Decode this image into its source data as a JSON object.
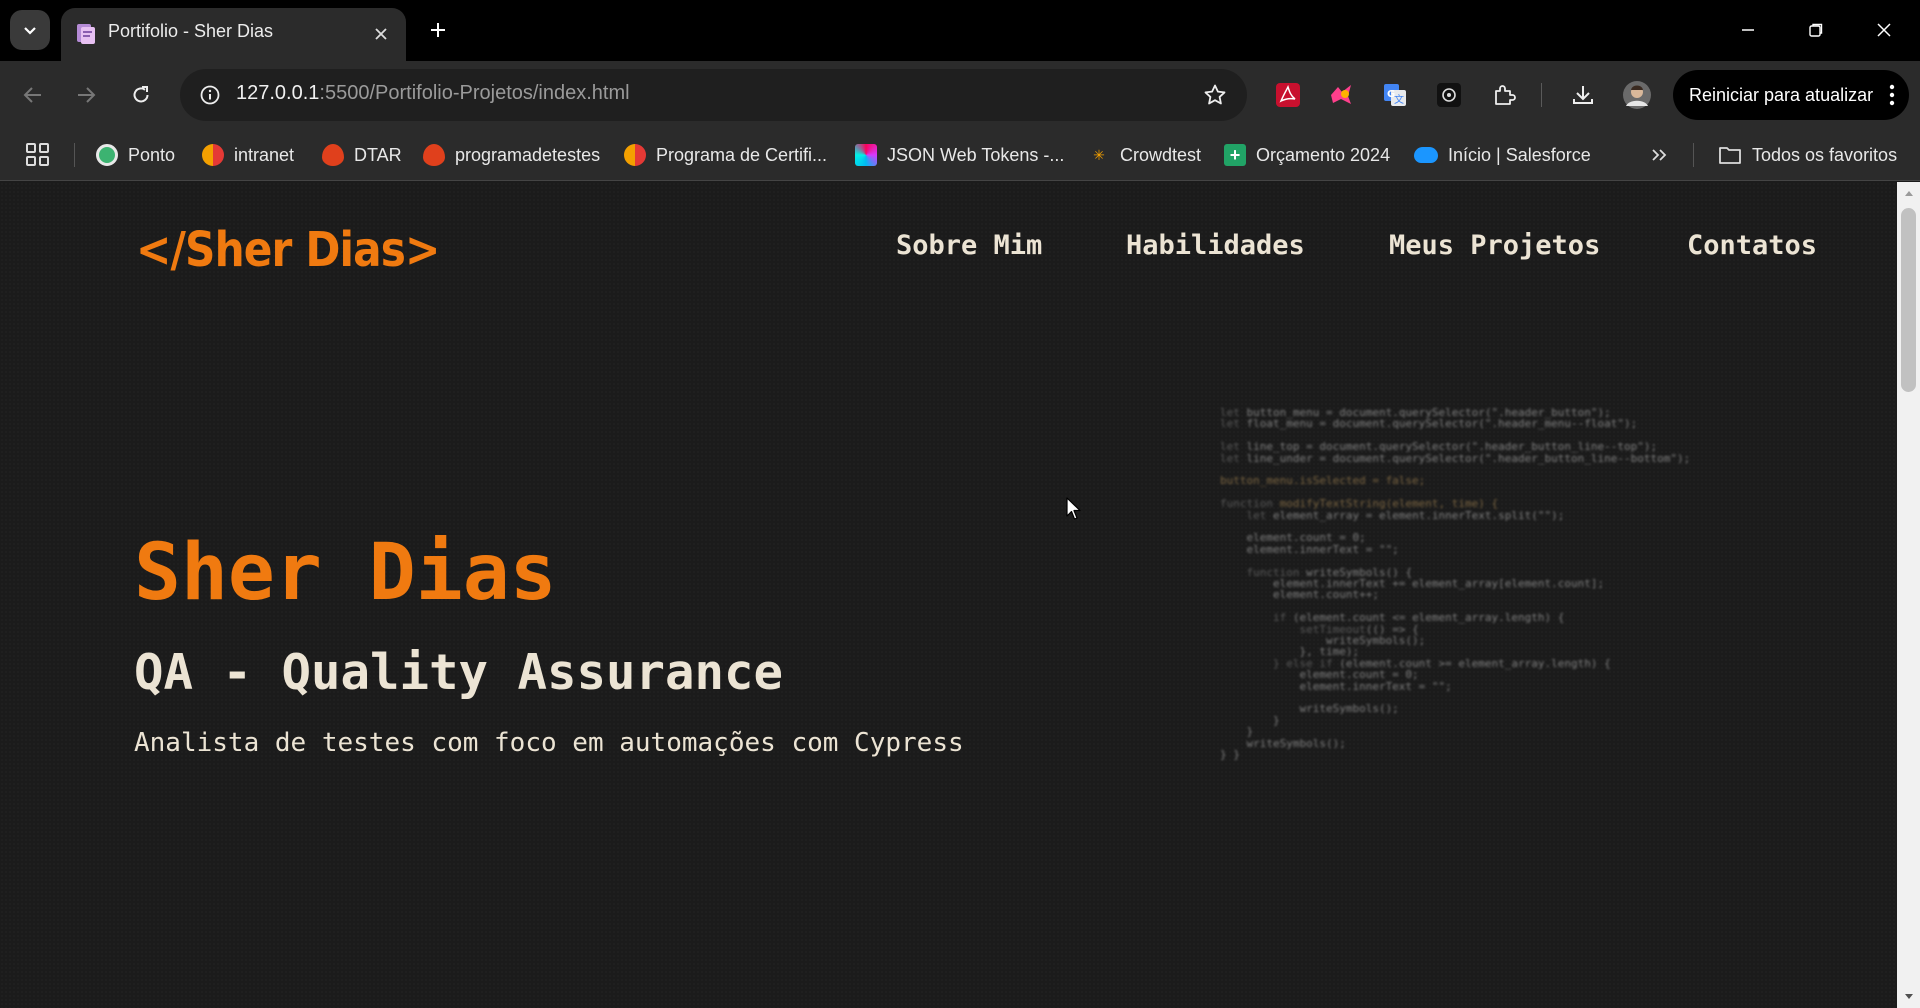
{
  "browser": {
    "tab": {
      "title": "Portifolio - Sher Dias"
    },
    "address_bar": {
      "url_host": "127.0.0.1",
      "url_path": ":5500/Portifolio-Projetos/index.html"
    },
    "restart_button": "Reiniciar para atualizar",
    "bookmarks": [
      {
        "label": "Ponto",
        "color": "#3cb371"
      },
      {
        "label": "intranet",
        "color": "#f4a000"
      },
      {
        "label": "DTAR",
        "color": "#e0401c"
      },
      {
        "label": "programadetestes",
        "color": "#e0401c"
      },
      {
        "label": "Programa de Certifi...",
        "color": "#f4a000"
      },
      {
        "label": "JSON Web Tokens -...",
        "color": "#d63aff"
      },
      {
        "label": "Crowdtest",
        "color": "#f4a000"
      },
      {
        "label": "Orçamento 2024",
        "color": "#21a366"
      },
      {
        "label": "Início | Salesforce",
        "color": "#1b96ff"
      }
    ],
    "all_bookmarks": "Todos os favoritos"
  },
  "page": {
    "logo": "</Sher Dias>",
    "nav": {
      "about": "Sobre Mim",
      "skills": "Habilidades",
      "projects": "Meus Projetos",
      "contacts": "Contatos"
    },
    "hero": {
      "name": "Sher Dias",
      "role": "QA - Quality Assurance",
      "description": "Analista de testes com foco em automações com Cypress"
    },
    "code_background": [
      "let button_menu = document.querySelector(\".header_button\");",
      "let float_menu = document.querySelector(\".header_menu--float\");",
      "",
      "let line_top = document.querySelector(\".header_button_line--top\");",
      "let line_under = document.querySelector(\".header_button_line--bottom\");",
      "",
      "button_menu.isSelected = false;",
      "",
      "function modifyTextString(element, time) {",
      "    let element_array = element.innerText.split(\"\");",
      "",
      "    element.count = 0;",
      "    element.innerText = \"\";",
      "",
      "    function writeSymbols() {",
      "        element.innerText += element_array[element.count];",
      "        element.count++;",
      "",
      "        if (element.count <= element_array.length) {",
      "            setTimeout(() => {",
      "                writeSymbols();",
      "            }, time);",
      "        } else if (element.count >= element_array.length) {",
      "            element.count = 0;",
      "            element.innerText = \"\";",
      "",
      "            writeSymbols();",
      "        }",
      "    }",
      "    writeSymbols();",
      "} }"
    ],
    "colors": {
      "accent": "#f07a10",
      "text": "#ece4d4",
      "background": "#1b1b1b"
    }
  }
}
